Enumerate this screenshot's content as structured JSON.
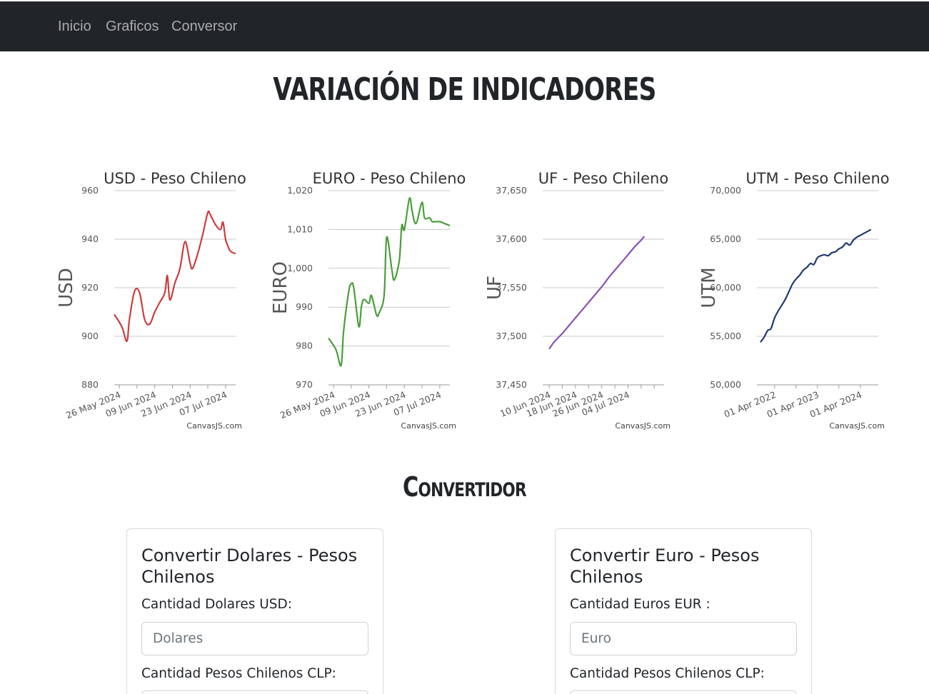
{
  "nav": {
    "items": [
      "Inicio",
      "Graficos",
      "Conversor"
    ]
  },
  "page_title": "VARIACIÓN DE INDICADORES",
  "section_title": "Convertidor",
  "credit": "CanvasJS.com",
  "chart_data": [
    {
      "type": "line",
      "title": "USD - Peso Chileno",
      "ylabel": "USD",
      "color": "#cc3d3d",
      "ylim": [
        880,
        960
      ],
      "yticks": [
        880,
        900,
        920,
        940,
        960
      ],
      "xlim": [
        "2024-05-24",
        "2024-07-11"
      ],
      "xticks": [
        "2024-05-26",
        "2024-06-09",
        "2024-06-23",
        "2024-07-07"
      ],
      "xtick_labels": [
        "26 May 2024",
        "09 Jun 2024",
        "23 Jun 2024",
        "07 Jul 2024"
      ],
      "minor_xticks": [
        "2024-06-02",
        "2024-06-16",
        "2024-06-30"
      ],
      "grid": true,
      "x": [
        "2024-05-24",
        "2024-05-27",
        "2024-05-29",
        "2024-05-30",
        "2024-06-01",
        "2024-06-03",
        "2024-06-05",
        "2024-06-07",
        "2024-06-09",
        "2024-06-11",
        "2024-06-13",
        "2024-06-14",
        "2024-06-15",
        "2024-06-17",
        "2024-06-19",
        "2024-06-21",
        "2024-06-23",
        "2024-06-24",
        "2024-06-26",
        "2024-06-28",
        "2024-06-30",
        "2024-07-01",
        "2024-07-03",
        "2024-07-05",
        "2024-07-06",
        "2024-07-07",
        "2024-07-08",
        "2024-07-09",
        "2024-07-11"
      ],
      "y": [
        909,
        904,
        898,
        907,
        918.5,
        918,
        907,
        905,
        910,
        914,
        918,
        925,
        915,
        922,
        928,
        939,
        930,
        928,
        934,
        942,
        951,
        950,
        946,
        944,
        947,
        940,
        937,
        935,
        934
      ]
    },
    {
      "type": "line",
      "title": "EURO - Peso Chileno",
      "ylabel": "EURO",
      "color": "#4a9e3b",
      "ylim": [
        970,
        1020
      ],
      "yticks": [
        970,
        980,
        990,
        1000,
        1010,
        1020
      ],
      "ytick_labels": [
        "970",
        "980",
        "990",
        "1,000",
        "1,010",
        "1,020"
      ],
      "xlim": [
        "2024-05-24",
        "2024-07-11"
      ],
      "xticks": [
        "2024-05-26",
        "2024-06-09",
        "2024-06-23",
        "2024-07-07"
      ],
      "xtick_labels": [
        "26 May 2024",
        "09 Jun 2024",
        "23 Jun 2024",
        "07 Jul 2024"
      ],
      "minor_xticks": [
        "2024-06-02",
        "2024-06-16",
        "2024-06-30"
      ],
      "grid": true,
      "x": [
        "2024-05-24",
        "2024-05-27",
        "2024-05-29",
        "2024-05-30",
        "2024-06-01",
        "2024-06-02",
        "2024-06-03",
        "2024-06-05",
        "2024-06-06",
        "2024-06-07",
        "2024-06-09",
        "2024-06-10",
        "2024-06-12",
        "2024-06-13",
        "2024-06-15",
        "2024-06-16",
        "2024-06-18",
        "2024-06-19",
        "2024-06-21",
        "2024-06-22",
        "2024-06-23",
        "2024-06-25",
        "2024-06-26",
        "2024-06-27",
        "2024-06-28",
        "2024-06-30",
        "2024-07-01",
        "2024-07-03",
        "2024-07-04",
        "2024-07-05",
        "2024-07-07",
        "2024-07-09",
        "2024-07-11"
      ],
      "y": [
        982,
        979,
        975,
        984,
        994,
        996,
        995,
        985,
        990,
        992,
        991,
        993,
        988,
        988.5,
        993,
        1008,
        1000,
        997,
        1002,
        1011,
        1010,
        1018,
        1015,
        1012,
        1012,
        1017,
        1013,
        1013,
        1012,
        1012,
        1012,
        1011.5,
        1011
      ]
    },
    {
      "type": "line",
      "title": "UF - Peso Chileno",
      "ylabel": "UF",
      "color": "#8c4fb5",
      "ylim": [
        37450,
        37650
      ],
      "yticks": [
        37450,
        37500,
        37550,
        37600,
        37650
      ],
      "ytick_labels": [
        "37,450",
        "37,500",
        "37,550",
        "37,600",
        "37,650"
      ],
      "xlim": [
        "2024-06-08",
        "2024-07-15"
      ],
      "xticks": [
        "2024-06-10",
        "2024-06-18",
        "2024-06-26",
        "2024-07-04"
      ],
      "xtick_labels": [
        "10 Jun 2024",
        "18 Jun 2024",
        "26 Jun 2024",
        "04 Jul 2024"
      ],
      "minor_xticks": [
        "2024-06-14",
        "2024-06-22",
        "2024-06-30",
        "2024-07-08",
        "2024-07-12"
      ],
      "grid": true,
      "x": [
        "2024-06-10",
        "2024-06-11",
        "2024-06-12",
        "2024-06-14",
        "2024-06-16",
        "2024-06-18",
        "2024-06-20",
        "2024-06-22",
        "2024-06-24",
        "2024-06-26",
        "2024-06-28",
        "2024-06-30",
        "2024-07-02",
        "2024-07-04",
        "2024-07-06",
        "2024-07-08",
        "2024-07-09"
      ],
      "y": [
        37487,
        37492,
        37496,
        37503,
        37511,
        37519,
        37527,
        37535,
        37543,
        37551,
        37560,
        37568,
        37576,
        37584,
        37592,
        37599,
        37603
      ]
    },
    {
      "type": "line",
      "title": "UTM - Peso Chileno",
      "ylabel": "UTM",
      "color": "#1f3a73",
      "ylim": [
        50000,
        70000
      ],
      "yticks": [
        50000,
        55000,
        60000,
        65000,
        70000
      ],
      "ytick_labels": [
        "50,000",
        "55,000",
        "60,000",
        "65,000",
        "70,000"
      ],
      "xlim": [
        "2021-11-01",
        "2024-09-01"
      ],
      "xticks": [
        "2022-04-01",
        "2023-04-01",
        "2024-04-01"
      ],
      "xtick_labels": [
        "01 Apr 2022",
        "01 Apr 2023",
        "01 Apr 2024"
      ],
      "minor_xticks": [
        "2022-10-01",
        "2023-10-01"
      ],
      "grid": true,
      "x": [
        "2021-12-01",
        "2022-01-01",
        "2022-02-01",
        "2022-03-01",
        "2022-04-01",
        "2022-05-01",
        "2022-06-01",
        "2022-07-01",
        "2022-08-01",
        "2022-09-01",
        "2022-10-01",
        "2022-11-01",
        "2022-12-01",
        "2023-01-01",
        "2023-02-01",
        "2023-03-01",
        "2023-04-01",
        "2023-05-01",
        "2023-06-01",
        "2023-07-01",
        "2023-08-01",
        "2023-09-01",
        "2023-10-01",
        "2023-11-01",
        "2023-12-01",
        "2024-01-01",
        "2024-02-01",
        "2024-03-01",
        "2024-04-01",
        "2024-05-01",
        "2024-06-01",
        "2024-07-01"
      ],
      "y": [
        54400,
        54900,
        55600,
        55800,
        56900,
        57600,
        58200,
        58800,
        59600,
        60400,
        60900,
        61300,
        61800,
        62100,
        62500,
        62400,
        63100,
        63300,
        63400,
        63300,
        63600,
        63700,
        64000,
        64200,
        64600,
        64400,
        64900,
        65200,
        65400,
        65600,
        65800,
        66000
      ]
    }
  ],
  "converter": {
    "usd": {
      "title": "Convertir Dolares - Pesos Chilenos",
      "amount_label": "Cantidad Dolares USD:",
      "amount_placeholder": "Dolares",
      "clp_label": "Cantidad Pesos Chilenos CLP:"
    },
    "eur": {
      "title": "Convertir Euro - Pesos Chilenos",
      "amount_label": "Cantidad Euros EUR :",
      "amount_placeholder": "Euro",
      "clp_label": "Cantidad Pesos Chilenos CLP:"
    }
  }
}
